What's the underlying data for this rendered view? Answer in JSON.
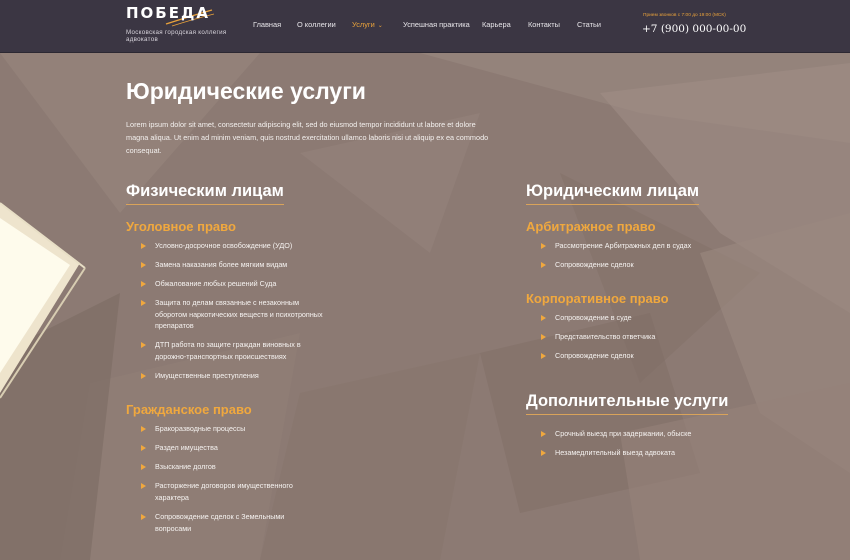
{
  "header": {
    "logo_word": "ПОБЕДА",
    "logo_subtitle": "Московская городская коллегия адвокатов",
    "nav": [
      {
        "label": "Главная"
      },
      {
        "label": "О коллегии"
      },
      {
        "label": "Услуги",
        "active": true
      },
      {
        "label": "Успешная практика"
      },
      {
        "label": "Карьера"
      },
      {
        "label": "Контакты"
      },
      {
        "label": "Статьи"
      }
    ],
    "hours": "Прием звонков с 7:00 до 19:00 (МСК)",
    "phone": "+7 (900) 000-00-00"
  },
  "main": {
    "title": "Юридические услуги",
    "intro": "Lorem ipsum dolor sit amet, consectetur adipiscing elit, sed do eiusmod tempor incididunt ut labore et dolore magna aliqua. Ut enim ad minim veniam, quis nostrud exercitation ullamco laboris nisi ut aliquip ex ea commodo consequat.",
    "individuals": {
      "title": "Физическим лицам",
      "criminal": {
        "title": "Уголовное право",
        "items": [
          "Условно-досрочное освобождение (УДО)",
          "Замена наказания более мягким видам",
          "Обжалование любых решений Суда",
          "Защита по делам связанные с незаконным оборотом наркотических веществ и психотропных препаратов",
          "ДТП работа по защите граждан виновных в дорожно-транспортных происшествиях",
          "Имущественные преступления"
        ]
      },
      "civil": {
        "title": "Гражданское право",
        "items": [
          "Бракоразводные процессы",
          "Раздел имущества",
          "Взыскание долгов",
          "Расторжение договоров имущественного характера",
          "Сопровождение сделок с Земельными вопросами"
        ]
      }
    },
    "entities": {
      "title": "Юридическим лицам",
      "arbitration": {
        "title": "Арбитражное право",
        "items": [
          "Рассмотрение Арбитражных дел в судах",
          "Сопровождение сделок"
        ]
      },
      "corporate": {
        "title": "Корпоративное право",
        "items": [
          "Сопровождение в суде",
          "Представительство ответчика",
          "Сопровождение сделок"
        ]
      }
    },
    "additional": {
      "title": "Дополнительные услуги",
      "items": [
        "Срочный выезд при задержании, обыске",
        "Незамедлительный выезд адвоката"
      ]
    }
  },
  "colors": {
    "header_bg": "#3b3643",
    "accent": "#f0a83e",
    "body_bg": "#8d7b74"
  }
}
